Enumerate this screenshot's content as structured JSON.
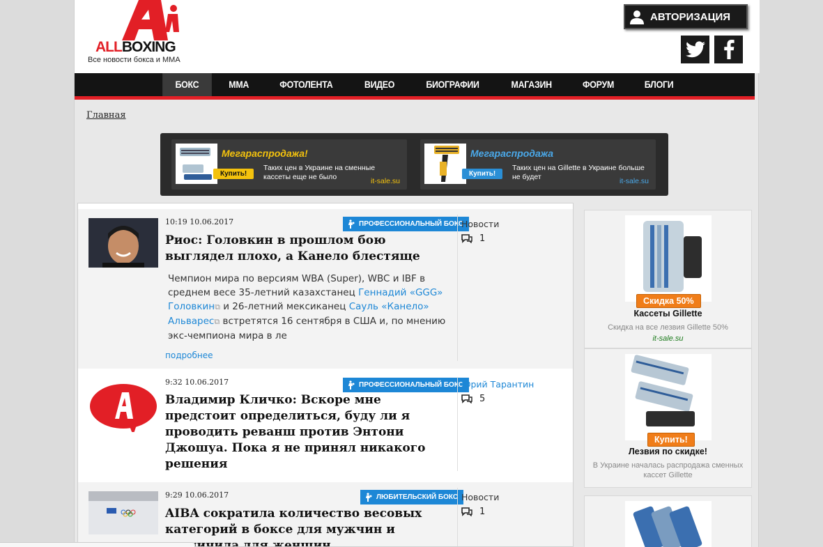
{
  "header": {
    "logo_all": "ALL",
    "logo_boxing": "BOXING",
    "tagline": "Все новости бокса и ММА",
    "auth_label": "АВТОРИЗАЦИЯ"
  },
  "nav": {
    "items": [
      {
        "label": "БОКС",
        "active": true
      },
      {
        "label": "ММА"
      },
      {
        "label": "ФОТОЛЕНТА"
      },
      {
        "label": "ВИДЕО"
      },
      {
        "label": "БИОГРАФИИ"
      },
      {
        "label": "МАГАЗИН"
      },
      {
        "label": "ФОРУМ"
      },
      {
        "label": "БЛОГИ"
      }
    ]
  },
  "breadcrumb": "Главная",
  "banner": {
    "ads": [
      {
        "title": "Мегараспродажа!",
        "buy": "Купить!",
        "desc": "Таких цен в Украине на сменные кассеты еще не было",
        "site": "it-sale.su"
      },
      {
        "title": "Мегараспродажа",
        "buy": "Купить!",
        "desc": "Таких цен на Gillette в Украине больше не будет",
        "site": "it-sale.su"
      }
    ]
  },
  "news": [
    {
      "time": "10:19 10.06.2017",
      "category": "ПРОФЕССИОНАЛЬНЫЙ БОКС",
      "title": "Риос: Головкин в прошлом бою выглядел плохо, а Канело блестяще",
      "body_1": "Чемпион мира по версиям WBA (Super), WBC и IBF в среднем весе 35-летний казахстанец ",
      "link_1": "Геннадий «GGG» Головкин",
      "body_2": " и 26-летний мексиканец ",
      "link_2": "Сауль «Канело» Альварес",
      "body_3": " встретятся 16 сентября в США и, по мнению экс-чемпиона мира в ле",
      "more": "подробнее",
      "source": "Новости",
      "comments": "1"
    },
    {
      "time": "9:32 10.06.2017",
      "category": "ПРОФЕССИОНАЛЬНЫЙ БОКС",
      "title": "Владимир Кличко: Вскоре мне предстоит определиться, буду ли я проводить реванш против Энтони Джошуа. Пока я не принял никакого решения",
      "source": "Юрий Тарантин",
      "comments": "5"
    },
    {
      "time": "9:29 10.06.2017",
      "category": "ЛЮБИТЕЛЬСКИЙ БОКС",
      "title": "AIBA сократила количество весовых категорий в боксе для мужчин и увеличила для женщин",
      "source": "Новости",
      "comments": "1"
    }
  ],
  "sidebar": [
    {
      "badge": "Скидка 50%",
      "title": "Кассеты Gillette",
      "desc": "Скидка на все лезвия Gillette 50%",
      "site": "it-sale.su"
    },
    {
      "badge": "Купить!",
      "title": "Лезвия по скидке!",
      "desc": "В Украине началась распродажа сменных кассет Gillette"
    }
  ],
  "colors": {
    "accent": "#e21f26",
    "link": "#1d87d6",
    "badge": "#f07d19"
  }
}
